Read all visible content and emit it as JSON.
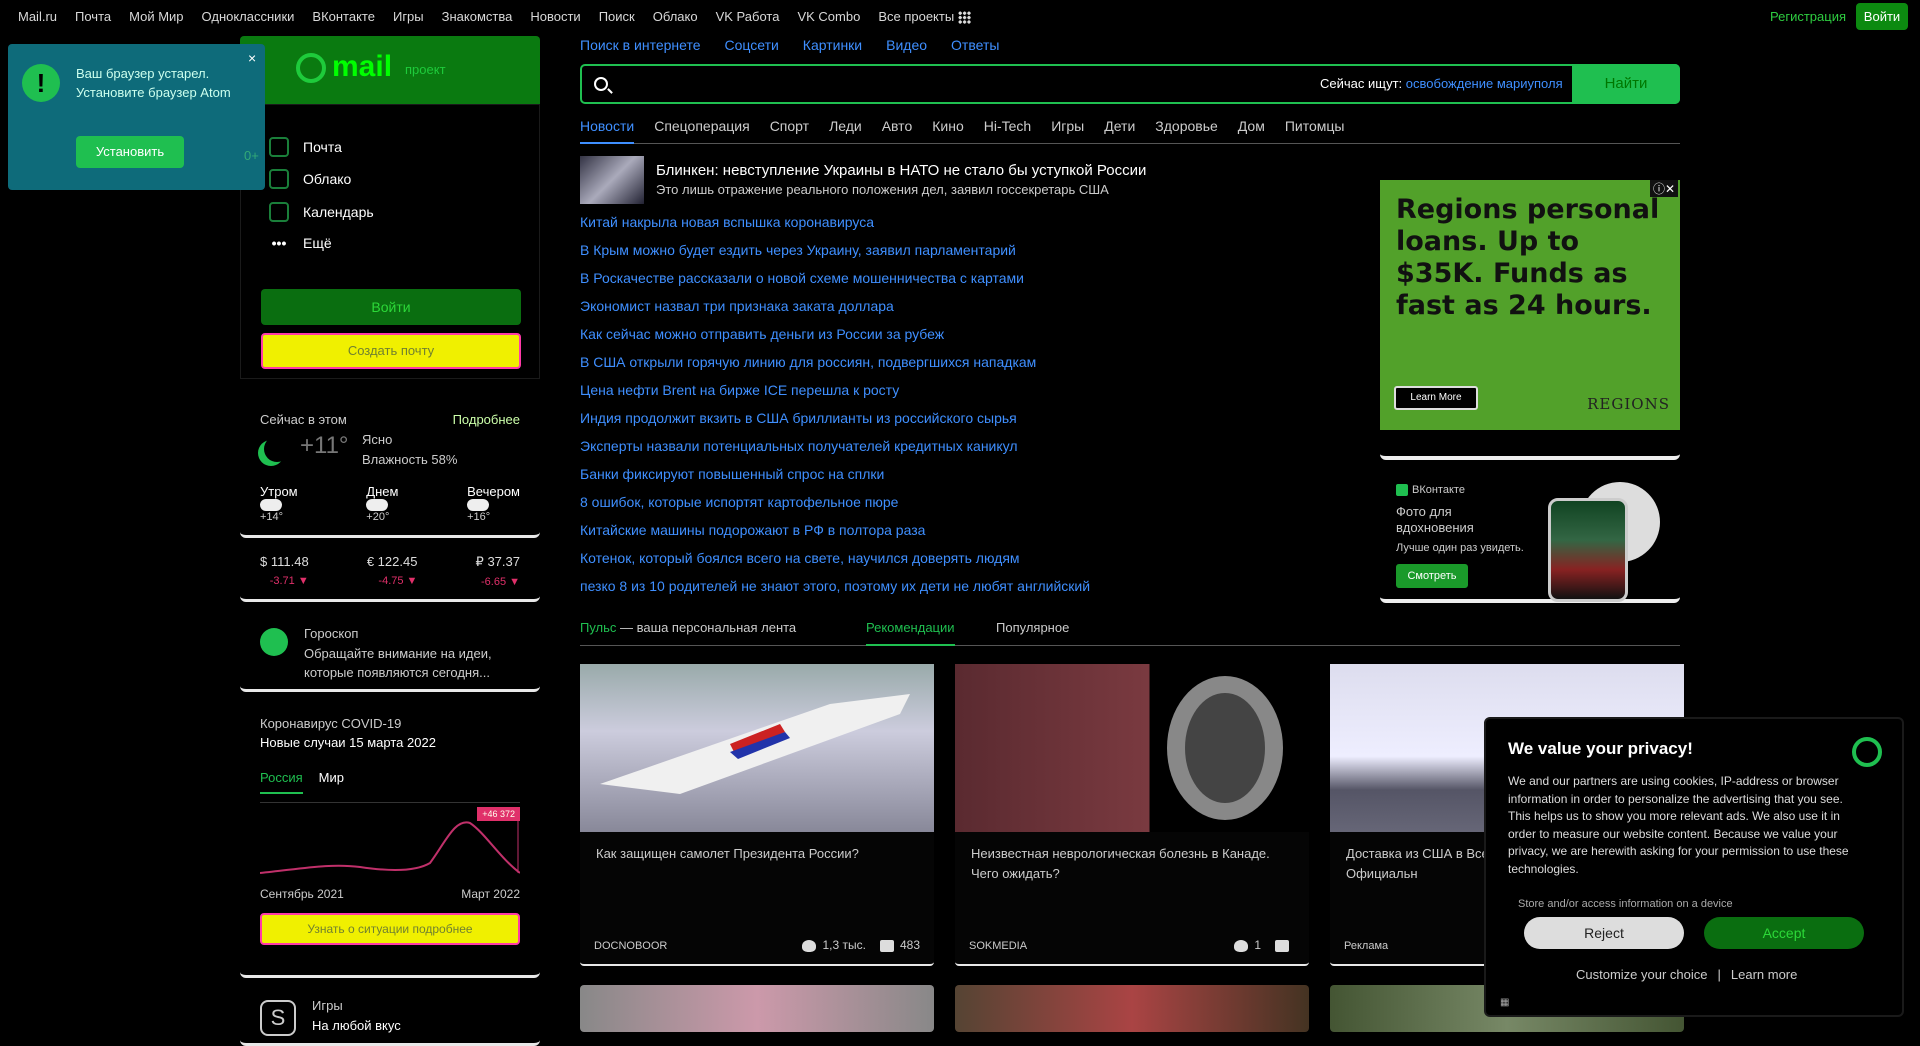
{
  "topbar": {
    "links": [
      "Mail.ru",
      "Почта",
      "Мой Мир",
      "Одноклассники",
      "ВКонтакте",
      "Игры",
      "Знакомства",
      "Новости",
      "Поиск",
      "Облако",
      "VK Работа",
      "VK Combo",
      "Все проекты"
    ],
    "register": "Регистрация",
    "login": "Войти"
  },
  "notification": {
    "text": "Ваш браузер устарел. Установите браузер Atom",
    "button": "Установить",
    "counter": "0+"
  },
  "mail": {
    "logo": "mail",
    "project": "проект",
    "items": [
      "Почта",
      "Облако",
      "Календарь",
      "Ещё"
    ],
    "login_button": "Войти",
    "create_button": "Создать почту"
  },
  "weather": {
    "title": "Сейчас в этом",
    "more": "Подробнее",
    "temp": "+11°",
    "condition": "Ясно",
    "humidity": "Влажность 58%",
    "parts": [
      {
        "label": "Утром",
        "temp": "+14°"
      },
      {
        "label": "Днем",
        "temp": "+20°"
      },
      {
        "label": "Вечером",
        "temp": "+16°"
      }
    ]
  },
  "rates": [
    {
      "sym": "$",
      "value": "111.48",
      "delta": "-3.71 ▼"
    },
    {
      "sym": "€",
      "value": "122.45",
      "delta": "-4.75 ▼"
    },
    {
      "sym": "₽",
      "value": "37.37",
      "delta": "-6.65 ▼"
    }
  ],
  "horoscope": {
    "title": "Гороскоп",
    "text": "Обращайте внимание на идеи, которые появляются сегодня..."
  },
  "covid": {
    "title": "Коронавирус COVID-19",
    "subtitle": "Новые случаи 15 марта 2022",
    "tabs": [
      "Россия",
      "Мир"
    ],
    "badge": "+46 372",
    "start_label": "Сентябрь 2021",
    "end_label": "Март 2022",
    "more": "Узнать о ситуации подробнее"
  },
  "games": {
    "title": "Игры",
    "subtitle": "На любой вкус"
  },
  "search": {
    "tabs": [
      "Поиск в интернете",
      "Соцсети",
      "Картинки",
      "Видео",
      "Ответы"
    ],
    "placeholder": "",
    "hint_label": "Сейчас ищут:",
    "hint_value": "освобождение мариуполя",
    "button": "Найти"
  },
  "news_tabs": [
    "Новости",
    "Спецоперация",
    "Спорт",
    "Леди",
    "Авто",
    "Кино",
    "Hi-Tech",
    "Игры",
    "Дети",
    "Здоровье",
    "Дом",
    "Питомцы"
  ],
  "lead": {
    "title": "Блинкен: невступление Украины в НАТО не стало бы уступкой России",
    "subtitle": "Это лишь отражение реального положения дел, заявил госсекретарь США"
  },
  "headlines": [
    "Китай накрыла новая вспышка коронавируса",
    "В Крым можно будет ездить через Украину, заявил парламентарий",
    "В Роскачестве рассказали о новой схеме мошенничества с картами",
    "Экономист назвал три признака заката доллара",
    "Как сейчас можно отправить деньги из России за рубеж",
    "В США открыли горячую линию для россиян, подвергшихся нападкам",
    "Цена нефти Brent на бирже ICE перешла к росту",
    "Индия продолжит вкзить в США бриллианты из российского сырья",
    "Эксперты назвали потенциальных получателей кредитных каникул",
    "Банки фиксируют повышенный спрос на сплки",
    "8 ошибок, которые испортят картофельное пюре",
    "Китайские машины подорожают в РФ в полтора раза",
    "Котенок, который боялся всего на свете, научился доверять людям",
    "пезко 8 из 10 родителей не знают этого, поэтому их дети не любят английский"
  ],
  "ad1": {
    "headline": "Regions personal loans. Up to $35K. Funds as fast as 24 hours.",
    "button": "Learn More",
    "brand": "REGIONS"
  },
  "ad2": {
    "brand": "ВКонтакте",
    "headline": "Фото для вдохновения",
    "subline": "Лучше один раз увидеть.",
    "button": "Смотреть"
  },
  "feed": {
    "pulse": "Пульс",
    "pulse_desc": "— ваша персональная лента",
    "recommended": "Рекомендации",
    "popular": "Популярное",
    "cards": [
      {
        "title": "Как защищен самолет Президента России?",
        "source": "DOCNOBOOR",
        "likes": "1,3 тыс.",
        "comments": "483"
      },
      {
        "title": "Неизвестная неврологическая болезнь в Канаде. Чего ожидать?",
        "source": "SOKMEDIA",
        "likes": "1",
        "comments": ""
      },
      {
        "title": "Доставка из США в Все самый! Никто ! можно! Официальн",
        "source": "Реклама",
        "likes": "",
        "comments": ""
      }
    ]
  },
  "privacy": {
    "title": "We value your privacy!",
    "text": "We and our partners are using cookies, IP-address or browser information in order to personalize the advertising that you see. This helps us to show you more relevant ads. We also use it in order to measure our website content. Because we value your privacy, we are herewith asking for your permission to use these technologies.",
    "store": "Store and/or access information on a device",
    "reject": "Reject",
    "accept": "Accept",
    "customize": "Customize your choice",
    "learn": "Learn more"
  }
}
